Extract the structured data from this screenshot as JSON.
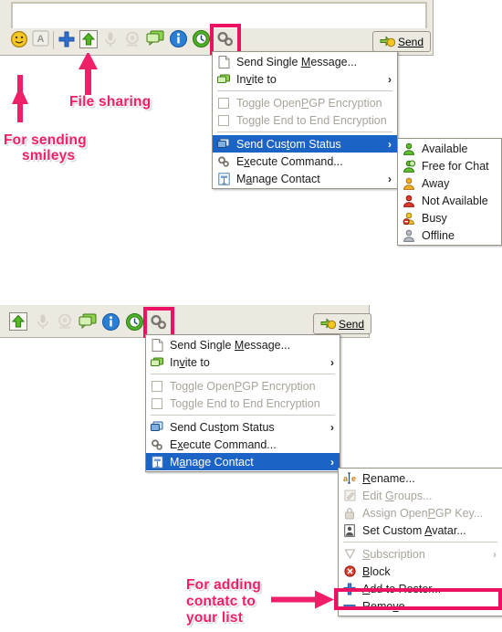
{
  "panel_top": {
    "message_input": {
      "value": "",
      "placeholder": ""
    },
    "toolbar_icons": [
      {
        "name": "smiley-icon",
        "label": "Smiley"
      },
      {
        "name": "font-icon",
        "label": "A"
      },
      {
        "name": "add-icon",
        "label": "Add"
      },
      {
        "name": "file-send-icon",
        "label": "Send file"
      },
      {
        "name": "microphone-icon",
        "label": "Audio"
      },
      {
        "name": "webcam-icon",
        "label": "Video"
      },
      {
        "name": "chat-icon",
        "label": "Chat"
      },
      {
        "name": "info-icon",
        "label": "Information"
      },
      {
        "name": "history-icon",
        "label": "History"
      },
      {
        "name": "actions-icon",
        "label": "Actions"
      }
    ],
    "send_button": {
      "label": "Send"
    },
    "menu": {
      "items": [
        {
          "label": "Send Single Message...",
          "icon": "document-icon",
          "state": "normal",
          "accel": "M",
          "submenu": false
        },
        {
          "label": "Invite to",
          "icon": "chat-icon",
          "state": "normal",
          "accel": "v",
          "submenu": true
        },
        {
          "separator": true
        },
        {
          "label": "Toggle OpenPGP Encryption",
          "icon": "checkbox-icon",
          "state": "disabled",
          "accel": "P",
          "submenu": false
        },
        {
          "label": "Toggle End to End Encryption",
          "icon": "checkbox-icon",
          "state": "disabled",
          "accel": "",
          "submenu": false
        },
        {
          "separator": true
        },
        {
          "label": "Send Custom Status",
          "icon": "status-icon",
          "state": "selected",
          "accel": "t",
          "submenu": true
        },
        {
          "label": "Execute Command...",
          "icon": "gears-icon",
          "state": "normal",
          "accel": "x",
          "submenu": false
        },
        {
          "label": "Manage Contact",
          "icon": "contact-icon",
          "state": "normal",
          "accel": "a",
          "submenu": true
        }
      ]
    },
    "status_submenu": {
      "items": [
        {
          "label": "Available",
          "icon": "status-available-icon",
          "color": "#4caf2a"
        },
        {
          "label": "Free for Chat",
          "icon": "status-freeforchat-icon",
          "color": "#4caf2a"
        },
        {
          "label": "Away",
          "icon": "status-away-icon",
          "color": "#f0a424"
        },
        {
          "label": "Not Available",
          "icon": "status-notavailable-icon",
          "color": "#e02a24"
        },
        {
          "label": "Busy",
          "icon": "status-busy-icon",
          "color": "#e8b828"
        },
        {
          "label": "Offline",
          "icon": "status-offline-icon",
          "color": "#9aa0a6"
        }
      ]
    }
  },
  "panel_bottom": {
    "toolbar_icons": [
      {
        "name": "file-send-icon",
        "label": "Send file"
      },
      {
        "name": "microphone-icon",
        "label": "Audio"
      },
      {
        "name": "webcam-icon",
        "label": "Video"
      },
      {
        "name": "chat-icon",
        "label": "Chat"
      },
      {
        "name": "info-icon",
        "label": "Information"
      },
      {
        "name": "history-icon",
        "label": "History"
      },
      {
        "name": "actions-icon",
        "label": "Actions"
      }
    ],
    "send_button": {
      "label": "Send"
    },
    "menu": {
      "items": [
        {
          "label": "Send Single Message...",
          "icon": "document-icon",
          "state": "normal",
          "accel": "M",
          "submenu": false
        },
        {
          "label": "Invite to",
          "icon": "chat-icon",
          "state": "normal",
          "accel": "v",
          "submenu": true
        },
        {
          "separator": true
        },
        {
          "label": "Toggle OpenPGP Encryption",
          "icon": "checkbox-icon",
          "state": "disabled",
          "accel": "P",
          "submenu": false
        },
        {
          "label": "Toggle End to End Encryption",
          "icon": "checkbox-icon",
          "state": "disabled",
          "accel": "",
          "submenu": false
        },
        {
          "separator": true
        },
        {
          "label": "Send Custom Status",
          "icon": "status-icon",
          "state": "normal",
          "accel": "t",
          "submenu": true
        },
        {
          "label": "Execute Command...",
          "icon": "gears-icon",
          "state": "normal",
          "accel": "x",
          "submenu": false
        },
        {
          "label": "Manage Contact",
          "icon": "contact-icon",
          "state": "selected",
          "accel": "a",
          "submenu": true
        }
      ]
    },
    "manage_submenu": {
      "items": [
        {
          "label": "Rename...",
          "icon": "rename-icon",
          "state": "normal",
          "accel": "R",
          "submenu": false
        },
        {
          "label": "Edit Groups...",
          "icon": "editgroups-icon",
          "state": "disabled",
          "accel": "G",
          "submenu": false
        },
        {
          "label": "Assign OpenPGP Key...",
          "icon": "key-icon",
          "state": "disabled",
          "accel": "P",
          "submenu": false
        },
        {
          "label": "Set Custom Avatar...",
          "icon": "avatar-icon",
          "state": "normal",
          "accel": "A",
          "submenu": false
        },
        {
          "separator": true
        },
        {
          "label": "Subscription",
          "icon": "subscription-icon",
          "state": "disabled",
          "accel": "S",
          "submenu": true
        },
        {
          "label": "Block",
          "icon": "block-icon",
          "state": "normal",
          "accel": "B",
          "submenu": false
        },
        {
          "label": "Add to Roster...",
          "icon": "add-icon",
          "state": "normal",
          "accel": "A",
          "submenu": false
        },
        {
          "label": "Remove",
          "icon": "remove-icon",
          "state": "normal",
          "accel": "v",
          "submenu": false
        }
      ]
    }
  },
  "annotations": {
    "accent_color": "#ef1f6a",
    "highlight_color": "#ec1163",
    "notes": [
      {
        "name": "note-file-sharing",
        "text": "File sharing"
      },
      {
        "name": "note-for-sending",
        "text": "For sending"
      },
      {
        "name": "note-smileys",
        "text": "smileys"
      },
      {
        "name": "note-for-adding",
        "text": "For adding"
      },
      {
        "name": "note-contacts",
        "text": "contatc to"
      },
      {
        "name": "note-your-list",
        "text": "your list"
      }
    ]
  }
}
